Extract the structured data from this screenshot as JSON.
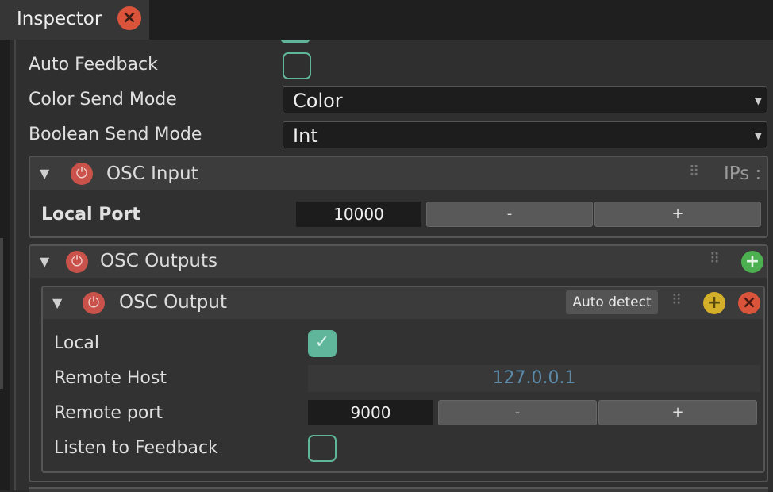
{
  "tab": {
    "title": "Inspector",
    "close_icon": "close-icon"
  },
  "rows": {
    "auto_feedback": {
      "label": "Auto Feedback",
      "checked": false
    },
    "color_send_mode": {
      "label": "Color Send Mode",
      "value": "Color"
    },
    "boolean_send_mode": {
      "label": "Boolean Send Mode",
      "value": "Int"
    }
  },
  "osc_input": {
    "title": "OSC Input",
    "ips_label": "IPs :",
    "local_port_label": "Local Port",
    "local_port_value": "10000",
    "minus_label": "-",
    "plus_label": "+"
  },
  "osc_outputs": {
    "title": "OSC Outputs",
    "add_icon": "+"
  },
  "osc_output": {
    "title": "OSC Output",
    "auto_detect_label": "Auto detect",
    "add_icon": "+",
    "remove_icon": "×",
    "local_label": "Local",
    "local_checked": true,
    "remote_host_label": "Remote Host",
    "remote_host_value": "127.0.0.1",
    "remote_port_label": "Remote port",
    "remote_port_value": "9000",
    "minus_label": "-",
    "plus_label": "+",
    "listen_label": "Listen to Feedback",
    "listen_checked": false
  },
  "colors": {
    "accent": "#5fb69b",
    "power": "#c9524b",
    "add_green": "#4caf50",
    "add_yellow": "#d4b02a",
    "remove_red": "#d9543a"
  }
}
